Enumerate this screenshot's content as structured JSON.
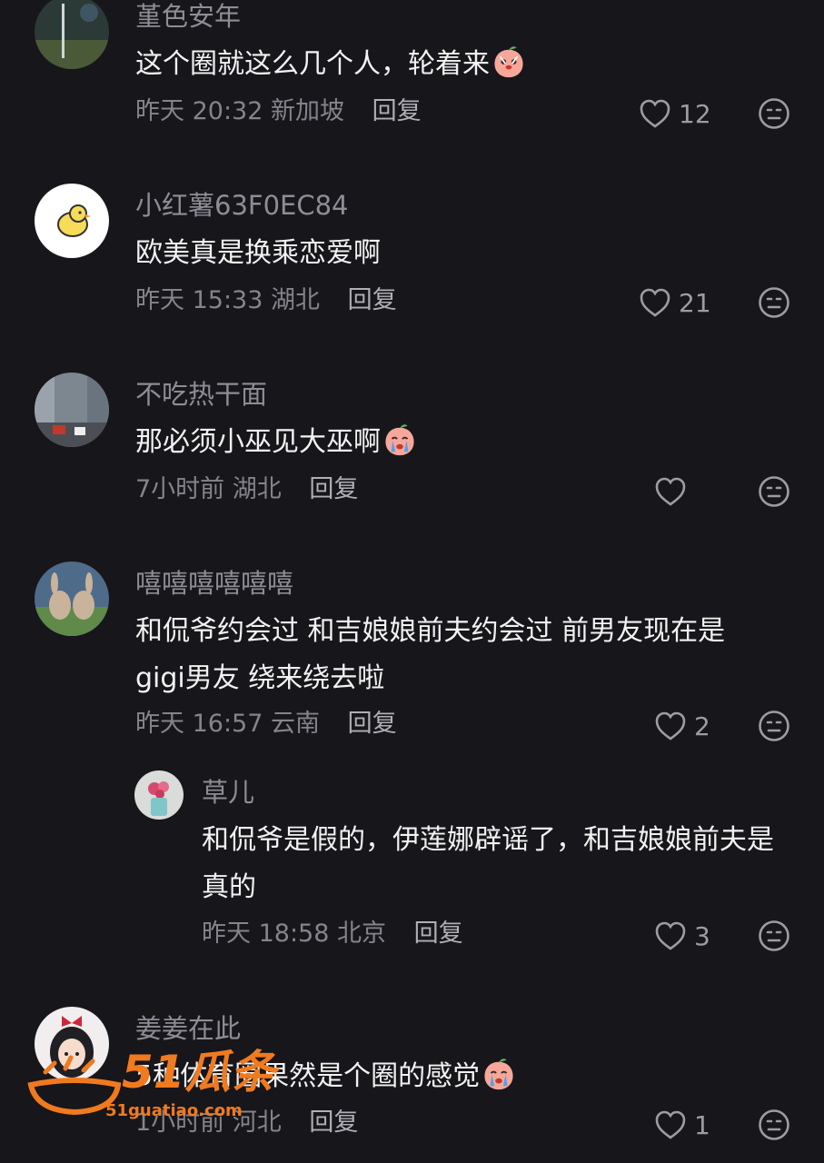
{
  "comments": [
    {
      "username": "堇色安年",
      "text": "这个圈就这么几个人，轮着来",
      "emoji": "shocked-peach-emoji",
      "time": "昨天 20:32",
      "location": "新加坡",
      "reply": "回复",
      "likes": "12"
    },
    {
      "username": "小红薯63F0EC84",
      "text": "欧美真是换乘恋爱啊",
      "time": "昨天 15:33",
      "location": "湖北",
      "reply": "回复",
      "likes": "21"
    },
    {
      "username": "不吃热干面",
      "text": "那必须小巫见大巫啊",
      "emoji": "crying-peach-emoji",
      "time": "7小时前",
      "location": "湖北",
      "reply": "回复",
      "likes": ""
    },
    {
      "username": "嘻嘻嘻嘻嘻嘻",
      "text": "和侃爷约会过 和吉娘娘前夫约会过 前男友现在是gigi男友 绕来绕去啦",
      "time": "昨天 16:57",
      "location": "云南",
      "reply": "回复",
      "likes": "2"
    },
    {
      "username": "草儿",
      "text": "和侃爷是假的，伊莲娜辟谣了，和吉娘娘前夫是真的",
      "time": "昨天 18:58",
      "location": "北京",
      "reply": "回复",
      "likes": "3"
    },
    {
      "username": "姜姜在此",
      "text": "5种体育圈果然是个圈的感觉",
      "emoji": "crying-peach-emoji",
      "time": "1小时前",
      "location": "河北",
      "reply": "回复",
      "likes": "1"
    }
  ],
  "watermark": {
    "brand": "51瓜条",
    "url": "51guatiao.com"
  },
  "colors": {
    "background": "#17161b",
    "text": "#f2f2f2",
    "muted": "#85848b",
    "watermark": "#f07a1e"
  }
}
